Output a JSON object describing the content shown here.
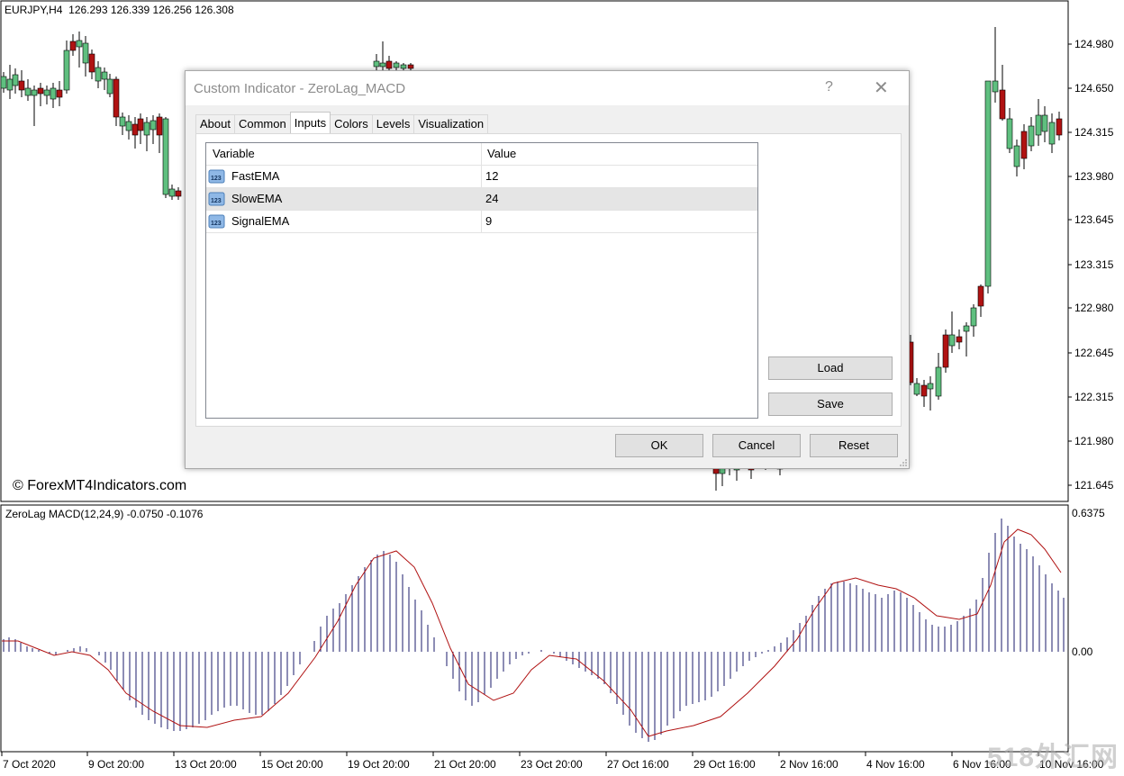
{
  "chart": {
    "ticker": "EURJPY,H4  126.293 126.339 126.256 126.308",
    "price_axis_labels": [
      "124.980",
      "124.650",
      "124.315",
      "123.980",
      "123.645",
      "123.315",
      "122.980",
      "122.645",
      "122.315",
      "121.980",
      "121.645"
    ],
    "time_axis_labels": [
      "7 Oct 2020",
      "9 Oct 20:00",
      "13 Oct 20:00",
      "15 Oct 20:00",
      "19 Oct 20:00",
      "21 Oct 20:00",
      "23 Oct 20:00",
      "27 Oct 16:00",
      "29 Oct 16:00",
      "2 Nov 16:00",
      "4 Nov 16:00",
      "6 Nov 16:00",
      "10 Nov 16:00"
    ],
    "copyright": "© ForexMT4Indicators.com",
    "watermark": "518外汇网",
    "colors": {
      "bull": "#5fbf7f",
      "bear": "#b01212",
      "histogram": "#1b1b6b",
      "signal": "#b01212"
    }
  },
  "indicator": {
    "title": "ZeroLag MACD(12,24,9) -0.0750 -0.1076",
    "axis_labels": [
      "0.6375",
      "0.00"
    ]
  },
  "dialog": {
    "title": "Custom Indicator - ZeroLag_MACD",
    "help": "?",
    "close": "✕",
    "tabs": [
      "About",
      "Common",
      "Inputs",
      "Colors",
      "Levels",
      "Visualization"
    ],
    "active_tab": "Inputs",
    "table": {
      "headers": [
        "Variable",
        "Value"
      ],
      "rows": [
        {
          "icon": "int-param-icon",
          "variable": "FastEMA",
          "value": "12"
        },
        {
          "icon": "int-param-icon",
          "variable": "SlowEMA",
          "value": "24"
        },
        {
          "icon": "int-param-icon",
          "variable": "SignalEMA",
          "value": "9"
        }
      ],
      "selected_row": 1
    },
    "buttons": {
      "load": "Load",
      "save": "Save",
      "ok": "OK",
      "cancel": "Cancel",
      "reset": "Reset"
    }
  }
}
